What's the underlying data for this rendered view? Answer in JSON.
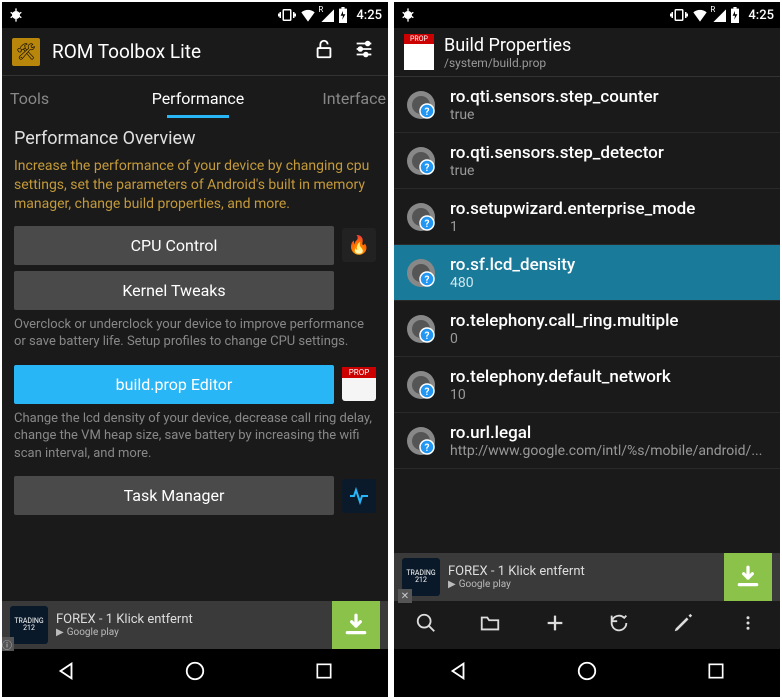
{
  "status": {
    "time": "4:25"
  },
  "screen1": {
    "app_title": "ROM Toolbox Lite",
    "tabs": {
      "tools": "Tools",
      "performance": "Performance",
      "interface": "Interface"
    },
    "section_title": "Performance Overview",
    "section_desc": "Increase the performance of your device by changing cpu settings, set the parameters of Android's built in memory manager, change build properties, and more.",
    "cpu_btn": "CPU Control",
    "kernel_btn": "Kernel Tweaks",
    "cpu_desc": "Overclock or underclock your device to improve performance or save battery life. Setup profiles to change CPU settings.",
    "buildprop_btn": "build.prop Editor",
    "buildprop_desc": "Change the lcd density of your device, decrease call ring delay, change the VM heap size, save battery by increasing the wifi scan interval, and more.",
    "task_btn": "Task Manager"
  },
  "ad": {
    "logo_line1": "TRADING",
    "logo_line2": "212",
    "title": "FOREX - 1 Klick entfernt",
    "store": "Google play"
  },
  "screen2": {
    "title": "Build Properties",
    "path": "/system/build.prop",
    "props": [
      {
        "key": "ro.qti.sensors.step_counter",
        "val": "true"
      },
      {
        "key": "ro.qti.sensors.step_detector",
        "val": "true"
      },
      {
        "key": "ro.setupwizard.enterprise_mode",
        "val": "1"
      },
      {
        "key": "ro.sf.lcd_density",
        "val": "480"
      },
      {
        "key": "ro.telephony.call_ring.multiple",
        "val": "0"
      },
      {
        "key": "ro.telephony.default_network",
        "val": "10"
      },
      {
        "key": "ro.url.legal",
        "val": "http://www.google.com/intl/%s/mobile/android/..."
      }
    ]
  },
  "chart_data": {
    "type": "table",
    "title": "build.prop properties",
    "rows": [
      [
        "ro.qti.sensors.step_counter",
        "true"
      ],
      [
        "ro.qti.sensors.step_detector",
        "true"
      ],
      [
        "ro.setupwizard.enterprise_mode",
        "1"
      ],
      [
        "ro.sf.lcd_density",
        "480"
      ],
      [
        "ro.telephony.call_ring.multiple",
        "0"
      ],
      [
        "ro.telephony.default_network",
        "10"
      ],
      [
        "ro.url.legal",
        "http://www.google.com/intl/%s/mobile/android/..."
      ]
    ]
  }
}
